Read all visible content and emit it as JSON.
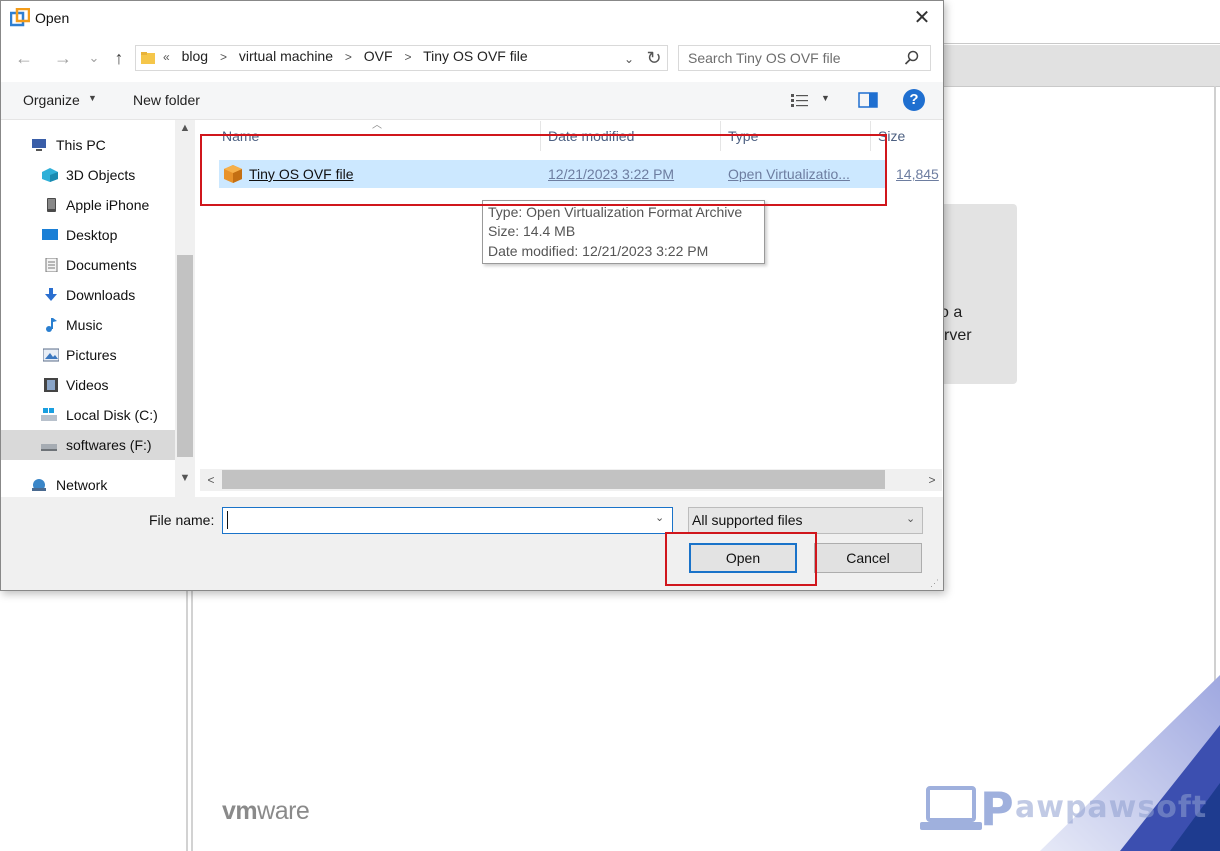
{
  "dialog": {
    "title": "Open",
    "close_glyph": "✕"
  },
  "navigation": {
    "back_glyph": "←",
    "forward_glyph": "→",
    "recent_glyph": "⌄",
    "up_glyph": "↑",
    "breadcrumb": [
      "«",
      "blog",
      "virtual machine",
      "OVF",
      "Tiny OS OVF file"
    ],
    "search_placeholder": "Search Tiny OS OVF file"
  },
  "toolbar": {
    "organize_label": "Organize",
    "new_folder_label": "New folder",
    "help_label": "?"
  },
  "sidebar": {
    "items": [
      {
        "label": "This PC",
        "icon": "this-pc-icon"
      },
      {
        "label": "3D Objects",
        "icon": "3d-objects-icon"
      },
      {
        "label": "Apple iPhone",
        "icon": "phone-icon"
      },
      {
        "label": "Desktop",
        "icon": "desktop-icon"
      },
      {
        "label": "Documents",
        "icon": "documents-icon"
      },
      {
        "label": "Downloads",
        "icon": "downloads-icon"
      },
      {
        "label": "Music",
        "icon": "music-icon"
      },
      {
        "label": "Pictures",
        "icon": "pictures-icon"
      },
      {
        "label": "Videos",
        "icon": "videos-icon"
      },
      {
        "label": "Local Disk (C:)",
        "icon": "local-disk-icon"
      },
      {
        "label": "softwares (F:)",
        "icon": "drive-icon"
      },
      {
        "label": "Network",
        "icon": "network-icon"
      }
    ],
    "selected": "softwares (F:)"
  },
  "file_list": {
    "columns": [
      "Name",
      "Date modified",
      "Type",
      "Size"
    ],
    "rows": [
      {
        "name": "Tiny OS OVF file",
        "date_modified": "12/21/2023 3:22 PM",
        "type": "Open Virtualizatio...",
        "size": "14,845"
      }
    ]
  },
  "tooltip": {
    "line1": "Type: Open Virtualization Format Archive",
    "line2": "Size: 14.4 MB",
    "line3": "Date modified: 12/21/2023 3:22 PM"
  },
  "bottom": {
    "filename_label": "File name:",
    "filename_value": "",
    "filetype_value": "All supported files",
    "open_label": "Open",
    "cancel_label": "Cancel"
  },
  "background": {
    "card_line1": "o a",
    "card_line2": "rver",
    "logo_vm": "vm",
    "logo_ware": "ware",
    "watermark": "awpawsoft",
    "watermark_letter": "P"
  },
  "colors": {
    "highlight": "#d0161c",
    "selection": "#cce8ff",
    "accent": "#1a73c9"
  }
}
